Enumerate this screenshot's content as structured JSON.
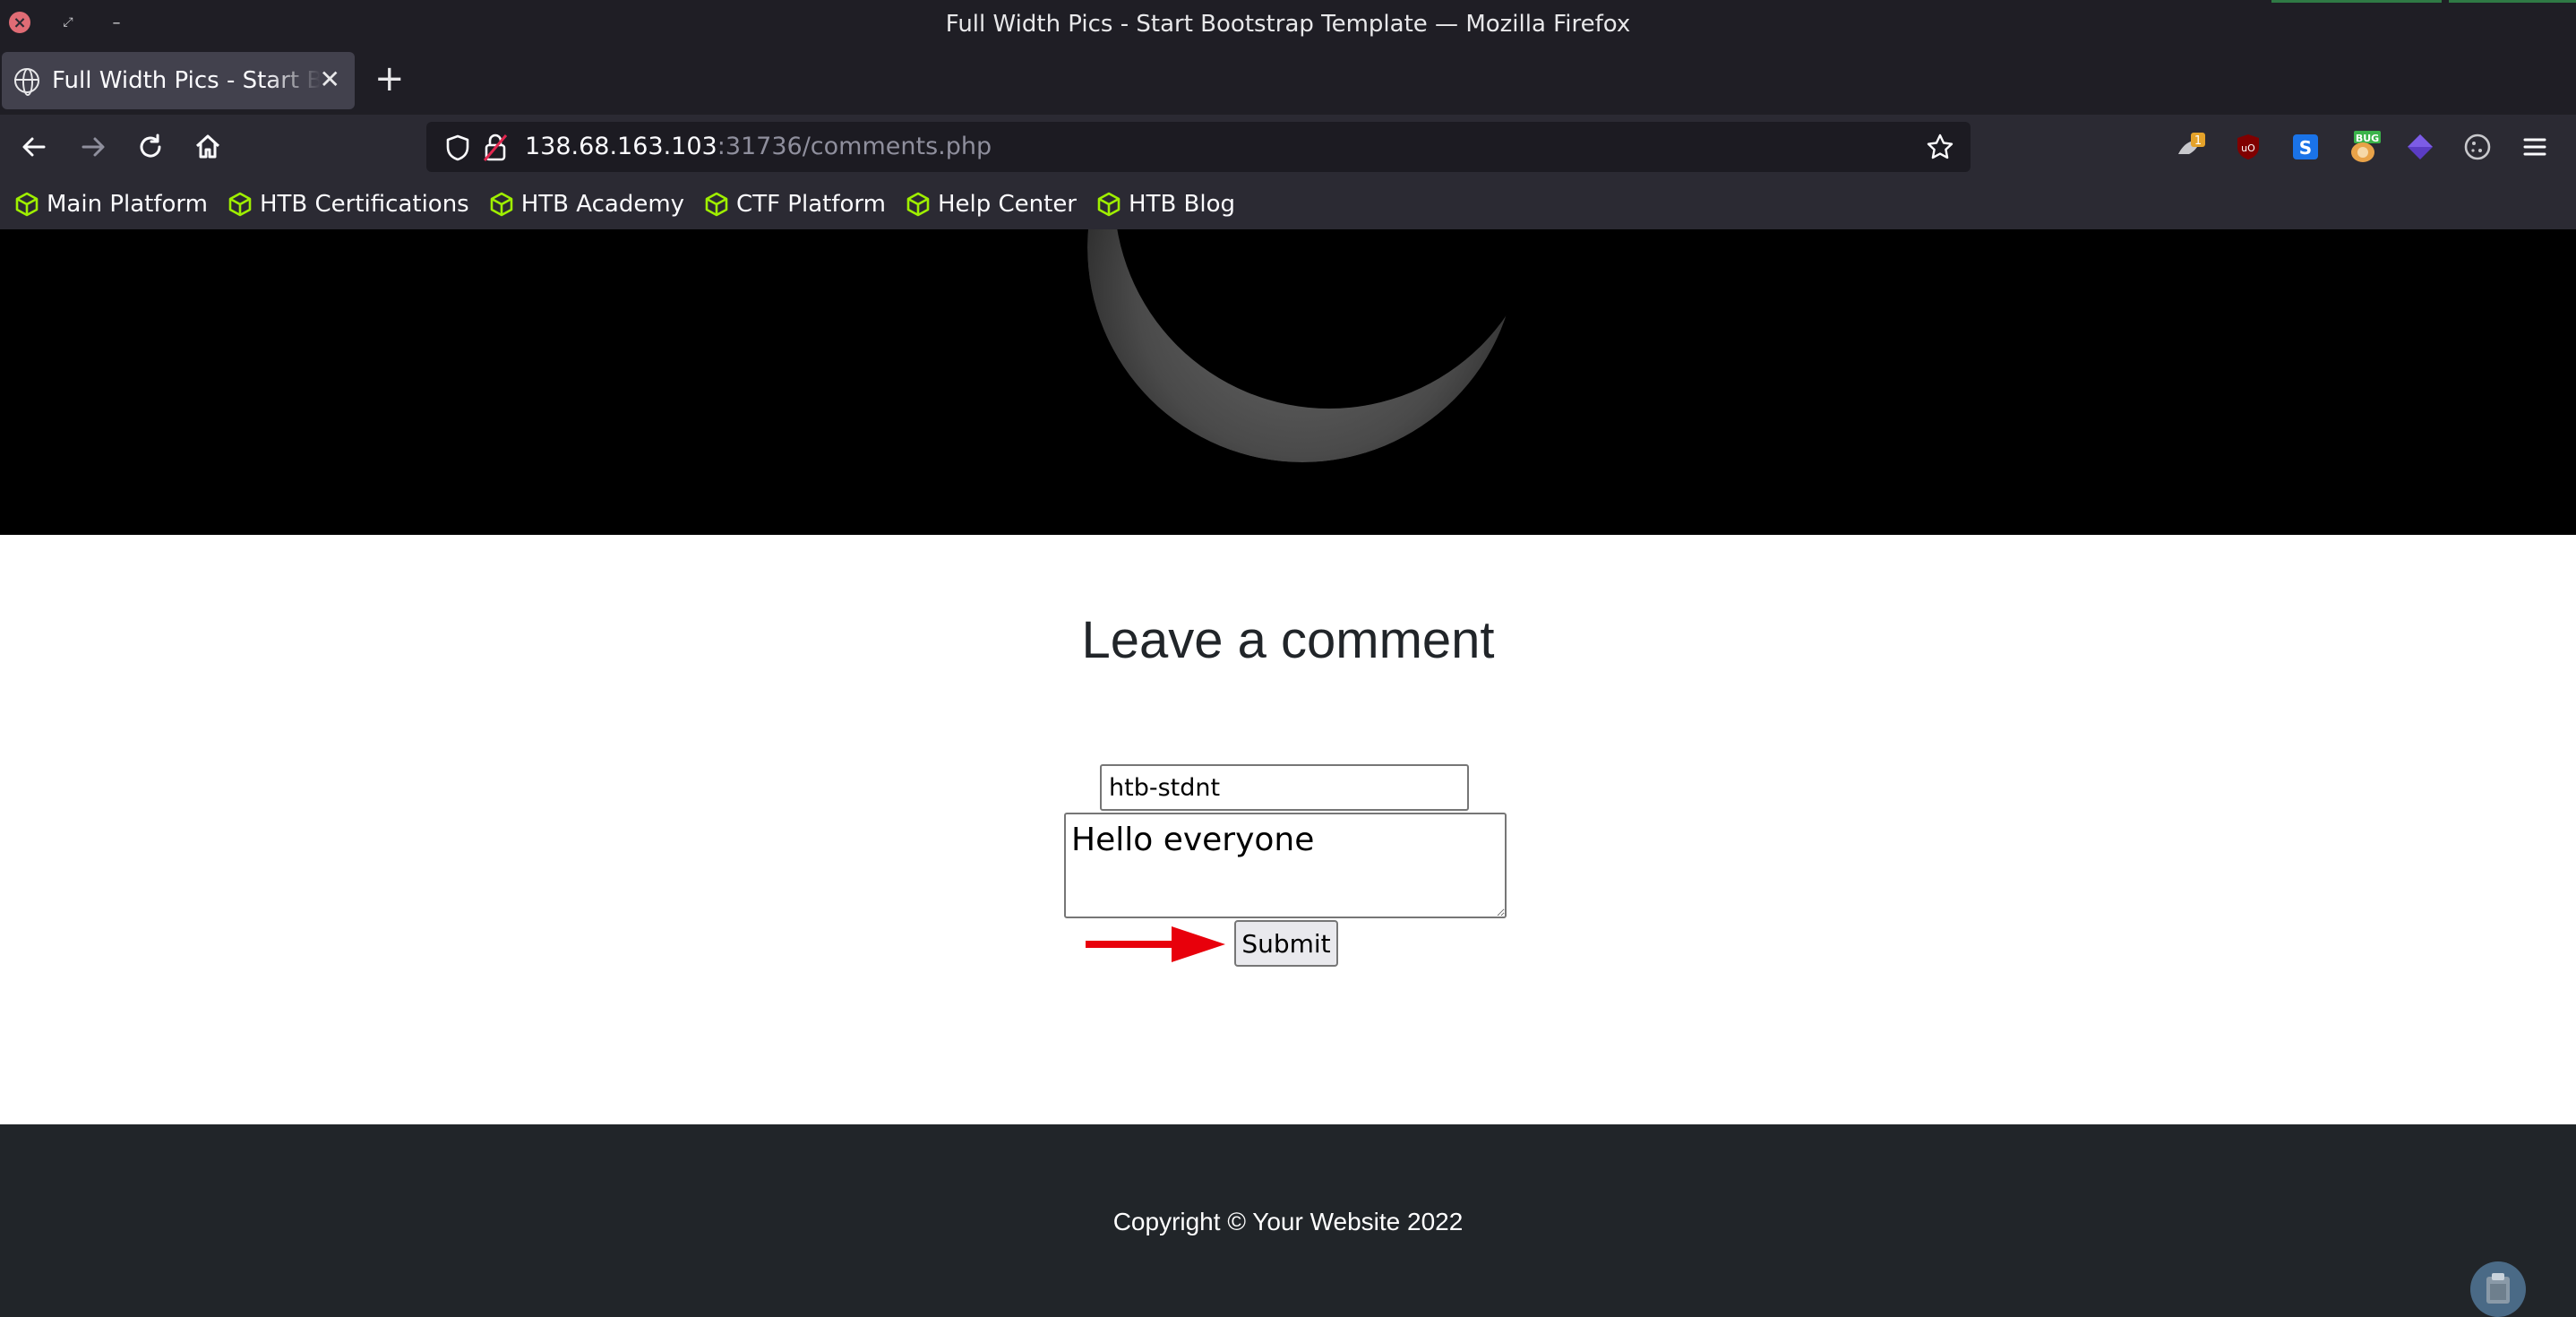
{
  "window": {
    "title": "Full Width Pics - Start Bootstrap Template — Mozilla Firefox"
  },
  "tabs": [
    {
      "label": "Full Width Pics - Start Bootstrap Template",
      "active": true
    }
  ],
  "navbar": {
    "url_host": "138.68.163.103",
    "url_rest": ":31736/comments.php"
  },
  "bookmarks": [
    {
      "label": "Main Platform"
    },
    {
      "label": "HTB Certifications"
    },
    {
      "label": "HTB Academy"
    },
    {
      "label": "CTF Platform"
    },
    {
      "label": "Help Center"
    },
    {
      "label": "HTB Blog"
    }
  ],
  "extensions": [
    {
      "icon": "foxyproxy-icon",
      "badge": "1",
      "color": "#e5a22a"
    },
    {
      "icon": "ublock-origin-icon",
      "color": "#800000"
    },
    {
      "icon": "s-extension-icon",
      "label": "S",
      "color": "#1a73e8"
    },
    {
      "icon": "bug-extension-icon",
      "label": "BUG",
      "color": "#e9a349"
    },
    {
      "icon": "purple-cube-icon",
      "color": "#5b3cc4"
    },
    {
      "icon": "cookie-icon",
      "color": "#c8c8cc"
    }
  ],
  "page": {
    "heading": "Leave a comment",
    "name_value": "htb-stdnt",
    "comment_value": "Hello everyone",
    "submit_label": "Submit",
    "footer": "Copyright © Your Website 2022"
  },
  "colors": {
    "accent_green": "#9fef00",
    "annotation_arrow": "#e8000b",
    "footer_bg": "#212529"
  }
}
